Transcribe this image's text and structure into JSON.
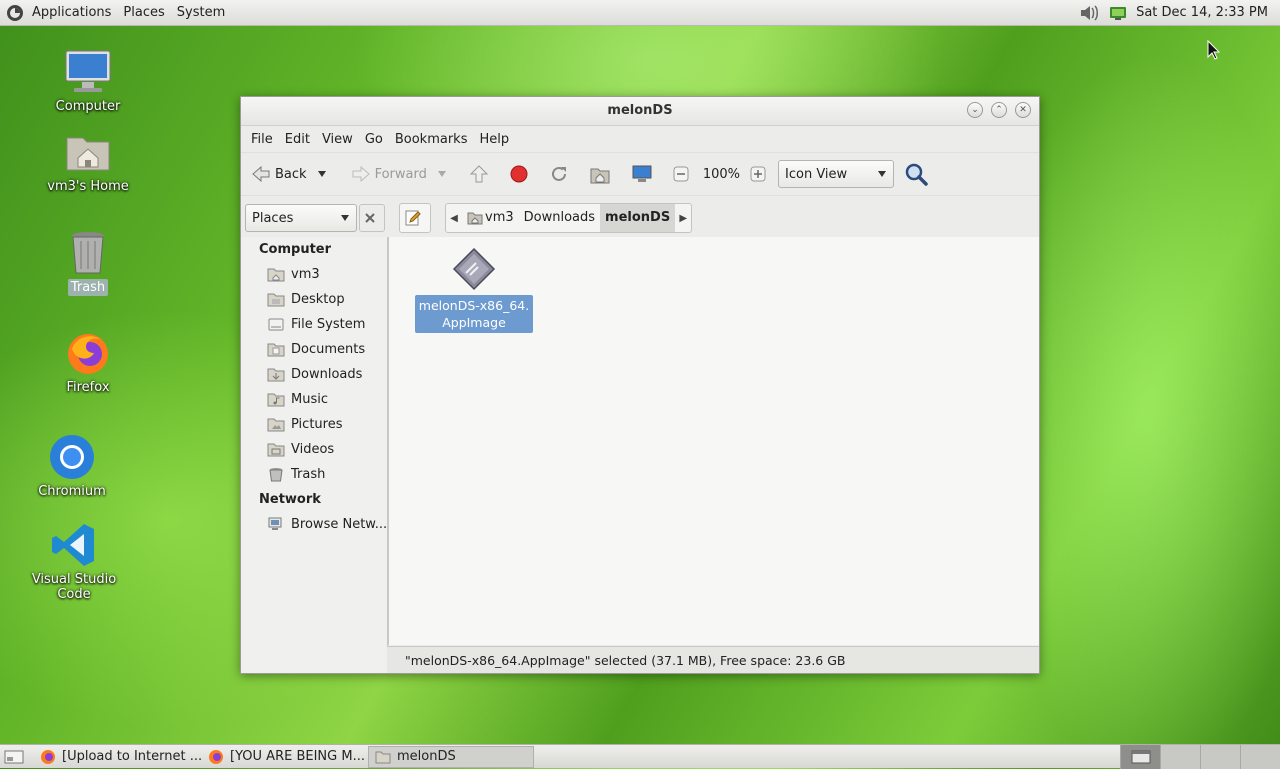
{
  "top_panel": {
    "menus": [
      "Applications",
      "Places",
      "System"
    ],
    "clock": "Sat Dec 14,  2:33 PM"
  },
  "desktop_icons": [
    {
      "label": "Computer",
      "icon": "computer-icon"
    },
    {
      "label": "vm3's Home",
      "icon": "home-folder-icon"
    },
    {
      "label": "Trash",
      "icon": "trash-icon"
    },
    {
      "label": "Firefox",
      "icon": "firefox-icon"
    },
    {
      "label": "Chromium",
      "icon": "chromium-icon"
    },
    {
      "label": "Visual Studio Code",
      "icon": "vscode-icon"
    }
  ],
  "window": {
    "title": "melonDS",
    "menubar": [
      "File",
      "Edit",
      "View",
      "Go",
      "Bookmarks",
      "Help"
    ],
    "toolbar": {
      "back": "Back",
      "forward": "Forward",
      "zoom": "100%",
      "view_mode": "Icon View"
    },
    "side_pane_selector": "Places",
    "breadcrumbs": [
      "vm3",
      "Downloads",
      "melonDS"
    ],
    "sidebar": {
      "computer_heading": "Computer",
      "computer_items": [
        "vm3",
        "Desktop",
        "File System",
        "Documents",
        "Downloads",
        "Music",
        "Pictures",
        "Videos",
        "Trash"
      ],
      "network_heading": "Network",
      "network_items": [
        "Browse Netw..."
      ]
    },
    "files": [
      {
        "name": "melonDS-x86_64.AppImage",
        "label_line1": "melonDS-x86_64.",
        "label_line2": "AppImage",
        "selected": true
      }
    ],
    "status": "\"melonDS-x86_64.AppImage\" selected (37.1 MB), Free space: 23.6 GB"
  },
  "taskbar": {
    "items": [
      "[Upload to Internet ...",
      "[YOU ARE BEING M...",
      "melonDS"
    ]
  },
  "colors": {
    "selection": "#6d9bd0",
    "desktop_green": "#63b628"
  }
}
